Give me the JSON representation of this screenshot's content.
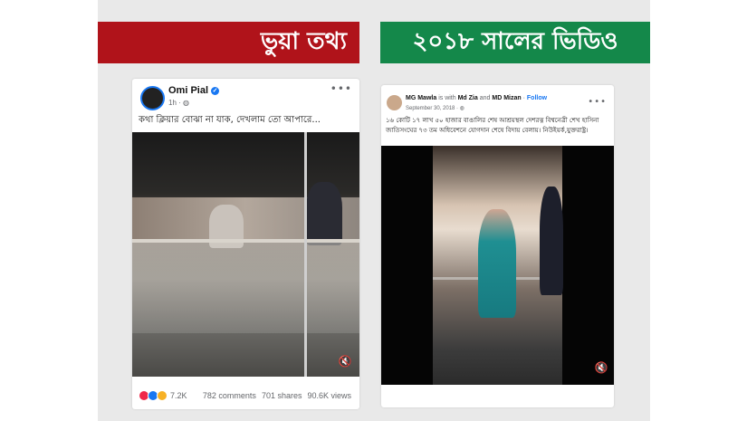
{
  "banners": {
    "left": "ভুয়া তথ্য",
    "right": "২০১৮ সালের ভিডিও"
  },
  "colors": {
    "false_banner": "#b0131a",
    "true_banner": "#14884a",
    "facebook_blue": "#1877f2"
  },
  "left_post": {
    "author": "Omi Pial",
    "time": "1h · ",
    "globe_icon": "globe-icon",
    "caption": "কথা ক্লিয়ার বোঝা না যাক, দেখলাম তো আপারে...",
    "more_icon": "•••",
    "mute_icon": "🔇",
    "reactions": {
      "count": "7.2K",
      "icons": [
        "angry-icon",
        "like-icon",
        "haha-icon"
      ]
    },
    "stats": {
      "comments": "782 comments",
      "shares": "701 shares",
      "views": "90.6K views"
    }
  },
  "right_post": {
    "author": "MG Mawla",
    "with_text": "is with",
    "tag1": "Md Zia",
    "and_text": "and",
    "tag2": "MD Mizan",
    "separator": "·",
    "follow": "Follow",
    "date": "September 30, 2018 · ",
    "caption": "১৬ কোটি ১৭ লাখ ৫০ হাজার বাঙালির শেষ আশ্রয়স্থল দেশরত্ন বিশ্বনেত্রী শেখ হাসিনা জাতিসংঘের ৭৩ তম অধিবেশনে যোগদান শেষে বিদায় বেলায়। নিউইয়র্ক,যুক্তরাষ্ট্র।",
    "more_icon": "•••",
    "mute_icon": "🔇"
  }
}
